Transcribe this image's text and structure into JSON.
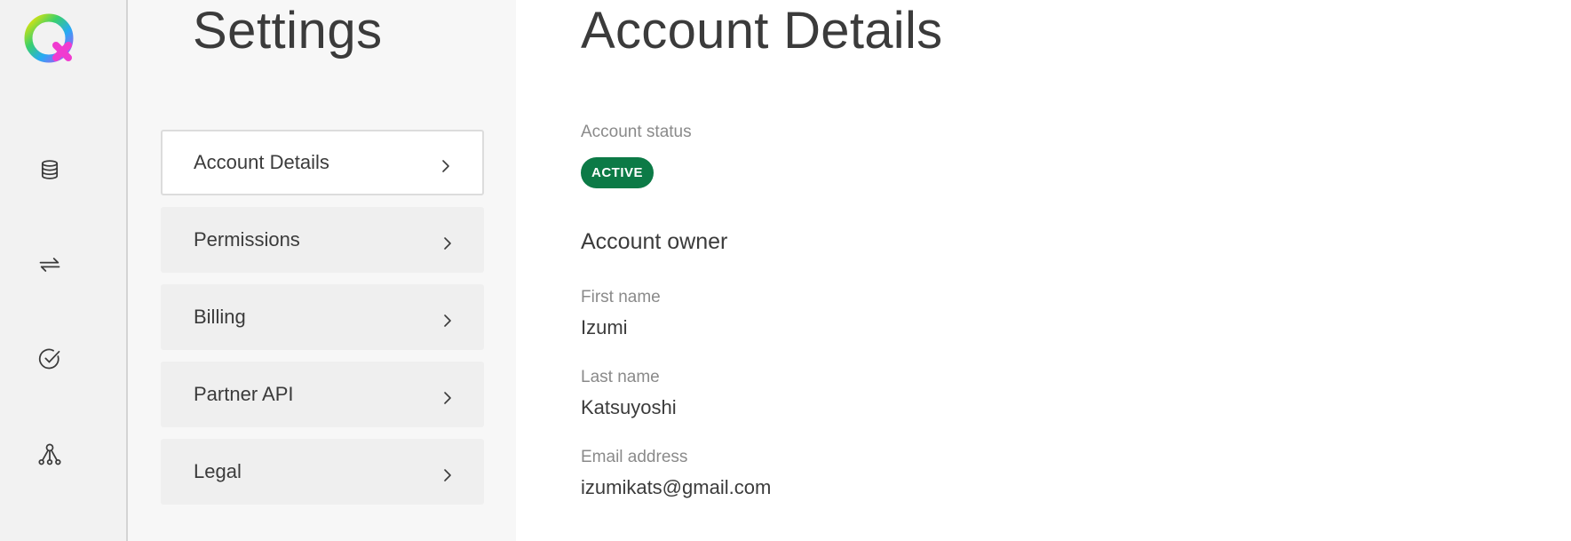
{
  "rail": {
    "logo_icon": "q-logo-icon",
    "items": [
      {
        "name": "database-icon"
      },
      {
        "name": "transfer-arrows-icon"
      },
      {
        "name": "check-circle-icon"
      },
      {
        "name": "network-nodes-icon"
      }
    ]
  },
  "subnav": {
    "title": "Settings",
    "items": [
      {
        "label": "Account Details",
        "active": true
      },
      {
        "label": "Permissions",
        "active": false
      },
      {
        "label": "Billing",
        "active": false
      },
      {
        "label": "Partner API",
        "active": false
      },
      {
        "label": "Legal",
        "active": false
      }
    ]
  },
  "main": {
    "title": "Account Details",
    "status_label": "Account status",
    "status_value": "ACTIVE",
    "owner_heading": "Account owner",
    "first_name_label": "First name",
    "first_name": "Izumi",
    "last_name_label": "Last name",
    "last_name": "Katsuyoshi",
    "email_label": "Email address",
    "email": "izumikats@gmail.com"
  },
  "colors": {
    "status_active": "#0c7a46",
    "rail_bg": "#f2f2f2",
    "subnav_bg": "#f7f7f7"
  }
}
